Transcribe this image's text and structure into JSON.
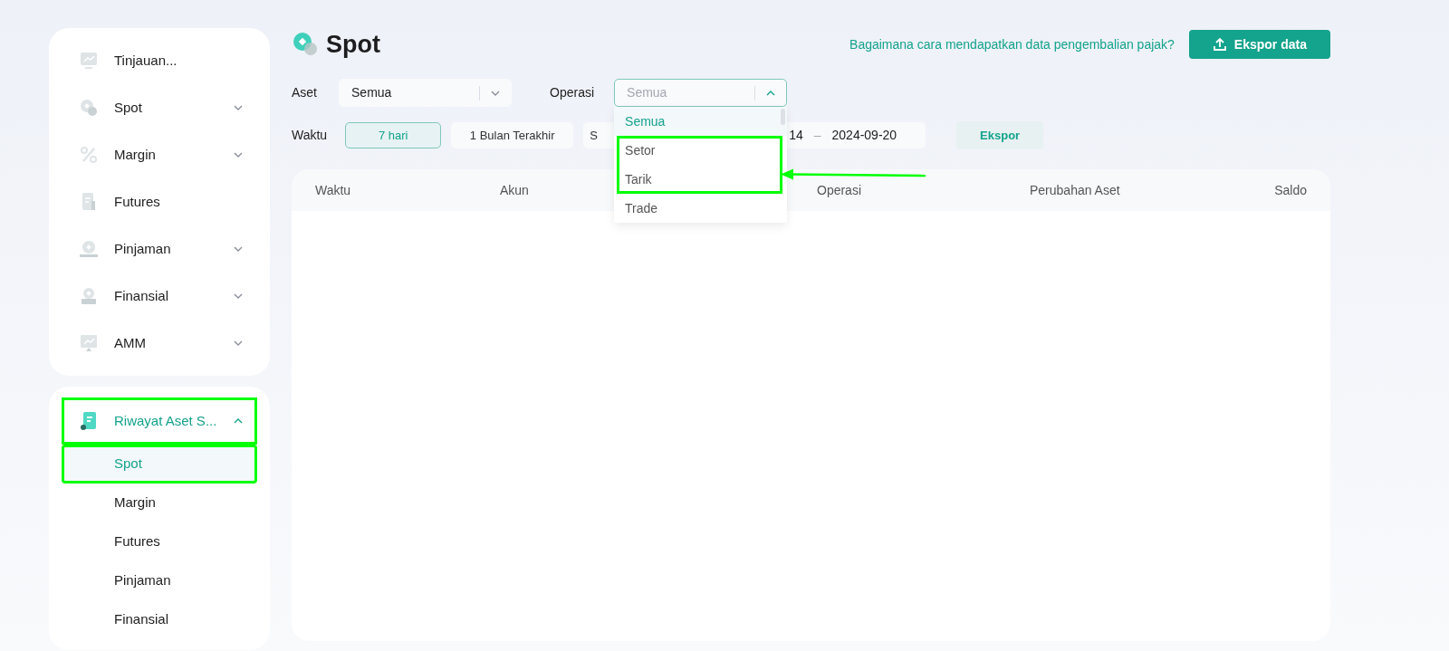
{
  "sidebar": {
    "menu": [
      {
        "label": "Tinjauan...",
        "has_submenu": false
      },
      {
        "label": "Spot",
        "has_submenu": true
      },
      {
        "label": "Margin",
        "has_submenu": true
      },
      {
        "label": "Futures",
        "has_submenu": false
      },
      {
        "label": "Pinjaman",
        "has_submenu": true
      },
      {
        "label": "Finansial",
        "has_submenu": true
      },
      {
        "label": "AMM",
        "has_submenu": true
      }
    ],
    "history": {
      "label": "Riwayat Aset S...",
      "expanded": true,
      "highlighted": true,
      "children": [
        {
          "label": "Spot",
          "selected": true,
          "highlighted": true
        },
        {
          "label": "Margin",
          "selected": false,
          "highlighted": false
        },
        {
          "label": "Futures",
          "selected": false,
          "highlighted": false
        },
        {
          "label": "Pinjaman",
          "selected": false,
          "highlighted": false
        },
        {
          "label": "Finansial",
          "selected": false,
          "highlighted": false
        }
      ]
    }
  },
  "header": {
    "title": "Spot",
    "help_link": "Bagaimana cara mendapatkan data pengembalian pajak?",
    "export_button": "Ekspor data"
  },
  "filters": {
    "asset": {
      "label": "Aset",
      "value": "Semua"
    },
    "operation": {
      "label": "Operasi",
      "placeholder": "Semua",
      "open": true,
      "options": [
        {
          "label": "Semua",
          "selected": true,
          "highlighted": false
        },
        {
          "label": "Setor",
          "selected": false,
          "highlighted": true
        },
        {
          "label": "Tarik",
          "selected": false,
          "highlighted": true
        },
        {
          "label": "Trade",
          "selected": false,
          "highlighted": false
        }
      ]
    },
    "time": {
      "label": "Waktu",
      "ranges": [
        {
          "label": "7 hari",
          "selected": true
        },
        {
          "label": "1 Bulan Terakhir",
          "selected": false
        },
        {
          "label": "S",
          "selected": false
        }
      ],
      "date_start": "14",
      "separator": "–",
      "date_end": "2024-09-20",
      "export": "Ekspor"
    }
  },
  "callout_arrow": true,
  "table": {
    "columns": [
      "Waktu",
      "Akun",
      "Operasi",
      "Perubahan Aset",
      "Saldo"
    ]
  }
}
